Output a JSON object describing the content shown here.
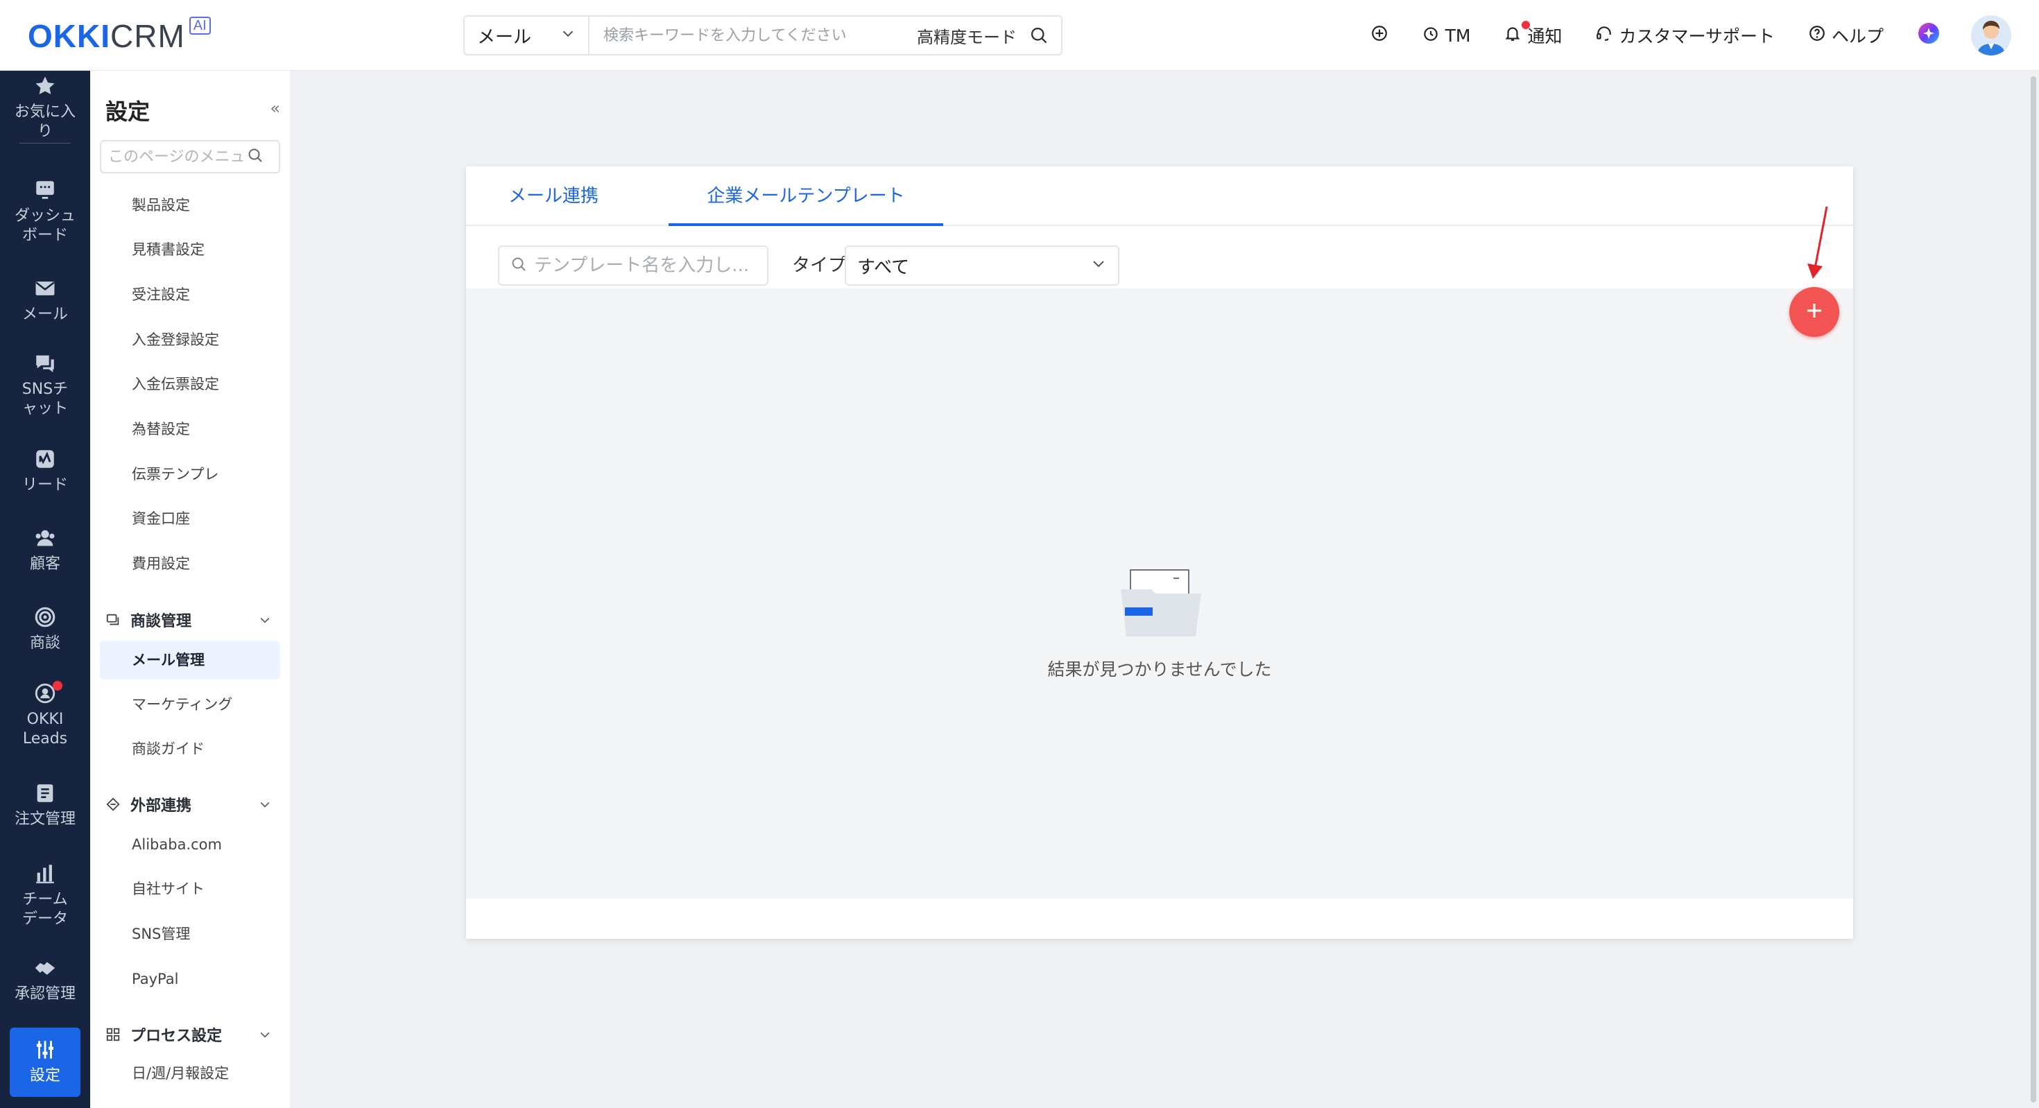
{
  "header": {
    "logo_okki": "OKKI",
    "logo_crm": "CRM",
    "logo_ai": "AI",
    "search_type": "メール",
    "search_placeholder": "検索キーワードを入力してください",
    "search_mode": "高精度モード",
    "items": {
      "tm": "TM",
      "notify": "通知",
      "support": "カスタマーサポート",
      "help": "ヘルプ"
    }
  },
  "leftnav": [
    {
      "label": "お気に入り",
      "icon": "star-icon"
    },
    {
      "label": "ダッシュボード",
      "icon": "dashboard-icon"
    },
    {
      "label": "メール",
      "icon": "mail-icon"
    },
    {
      "label": "SNSチャット",
      "icon": "chat-icon"
    },
    {
      "label": "リード",
      "icon": "lead-icon"
    },
    {
      "label": "顧客",
      "icon": "customer-icon"
    },
    {
      "label": "商談",
      "icon": "target-icon"
    },
    {
      "label": "OKKI Leads",
      "icon": "okki-leads-icon"
    },
    {
      "label": "注文管理",
      "icon": "order-icon"
    },
    {
      "label": "チームデータ",
      "icon": "chart-icon"
    },
    {
      "label": "承認管理",
      "icon": "approval-icon"
    },
    {
      "label": "設定",
      "icon": "settings-icon"
    }
  ],
  "sidepanel": {
    "title": "設定",
    "search_placeholder": "このページのメニュー",
    "items_top": [
      "製品設定",
      "見積書設定",
      "受注設定",
      "入金登録設定",
      "入金伝票設定",
      "為替設定",
      "伝票テンプレ",
      "資金口座",
      "費用設定"
    ],
    "group_deals": "商談管理",
    "items_deals": [
      "メール管理",
      "マーケティング",
      "商談ガイド"
    ],
    "group_external": "外部連携",
    "items_external": [
      "Alibaba.com",
      "自社サイト",
      "SNS管理",
      "PayPal"
    ],
    "group_process": "プロセス設定",
    "items_process": [
      "日/週/月報設定"
    ]
  },
  "main": {
    "tabs": [
      "メール連携",
      "企業メールテンプレート"
    ],
    "active_tab": 1,
    "filter_placeholder": "テンプレート名を入力し...",
    "type_label": "タイプ",
    "type_value": "すべて",
    "empty_text": "結果が見つかりませんでした"
  },
  "colors": {
    "brand": "#1a66e6",
    "nav_bg": "#16243f",
    "add_button": "#f25353",
    "arrow": "#e0242a"
  }
}
